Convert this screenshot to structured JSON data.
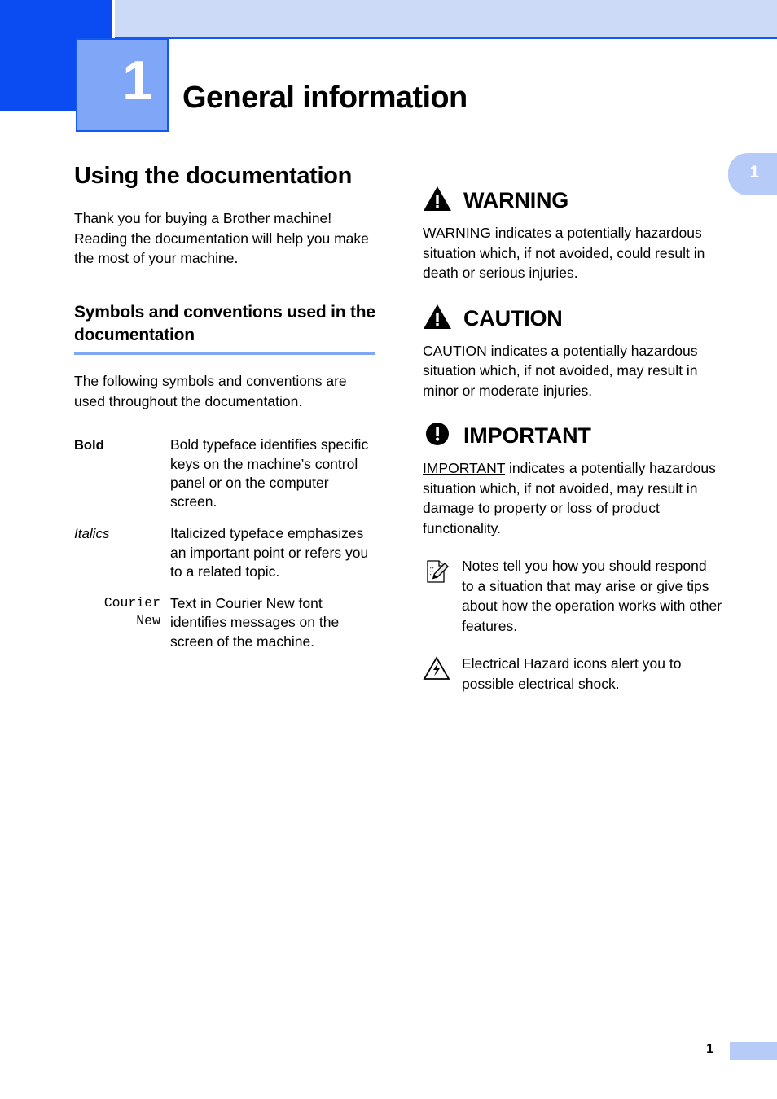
{
  "header": {
    "chapter_number": "1",
    "chapter_title": "General information",
    "side_tab_number": "1"
  },
  "left_column": {
    "section_title": "Using the documentation",
    "intro_paragraph": "Thank you for buying a Brother machine! Reading the documentation will help you make the most of your machine.",
    "subsection_title": "Symbols and conventions used in the documentation",
    "subsection_paragraph": "The following symbols and conventions are used throughout the documentation.",
    "conventions": [
      {
        "term": "Bold",
        "style": "bold",
        "description": "Bold typeface identifies specific keys on the machine’s control panel or on the computer screen."
      },
      {
        "term": "Italics",
        "style": "italic",
        "description": "Italicized typeface emphasizes an important point or refers you to a related topic."
      },
      {
        "term": "Courier New",
        "style": "monospace",
        "description": "Text in Courier New font identifies messages on the screen of the machine."
      }
    ]
  },
  "right_column": {
    "alerts": [
      {
        "icon": "warning-triangle-icon",
        "title": "WARNING",
        "lead": "WARNING",
        "body": " indicates a potentially hazardous situation which, if not avoided, could result in death or serious injuries."
      },
      {
        "icon": "caution-triangle-icon",
        "title": "CAUTION",
        "lead": "CAUTION",
        "body": " indicates a potentially hazardous situation which, if not avoided, may result in minor or moderate injuries."
      },
      {
        "icon": "important-circle-icon",
        "title": "IMPORTANT",
        "lead": "IMPORTANT",
        "body": " indicates a potentially hazardous situation which, if not avoided, may result in damage to property or loss of product functionality."
      }
    ],
    "notes": [
      {
        "icon": "note-pencil-icon",
        "text": "Notes tell you how you should respond to a situation that may arise or give tips about how the operation works with other features."
      },
      {
        "icon": "electrical-hazard-icon",
        "text": "Electrical Hazard icons alert you to possible electrical shock."
      }
    ]
  },
  "footer": {
    "page_number": "1"
  },
  "colors": {
    "dark_blue": "#0b4cf2",
    "mid_blue": "#1258f5",
    "chapter_blue": "#7fa6f7",
    "banner_blue": "#ccd9f7",
    "tab_blue": "#b7cbf8"
  }
}
